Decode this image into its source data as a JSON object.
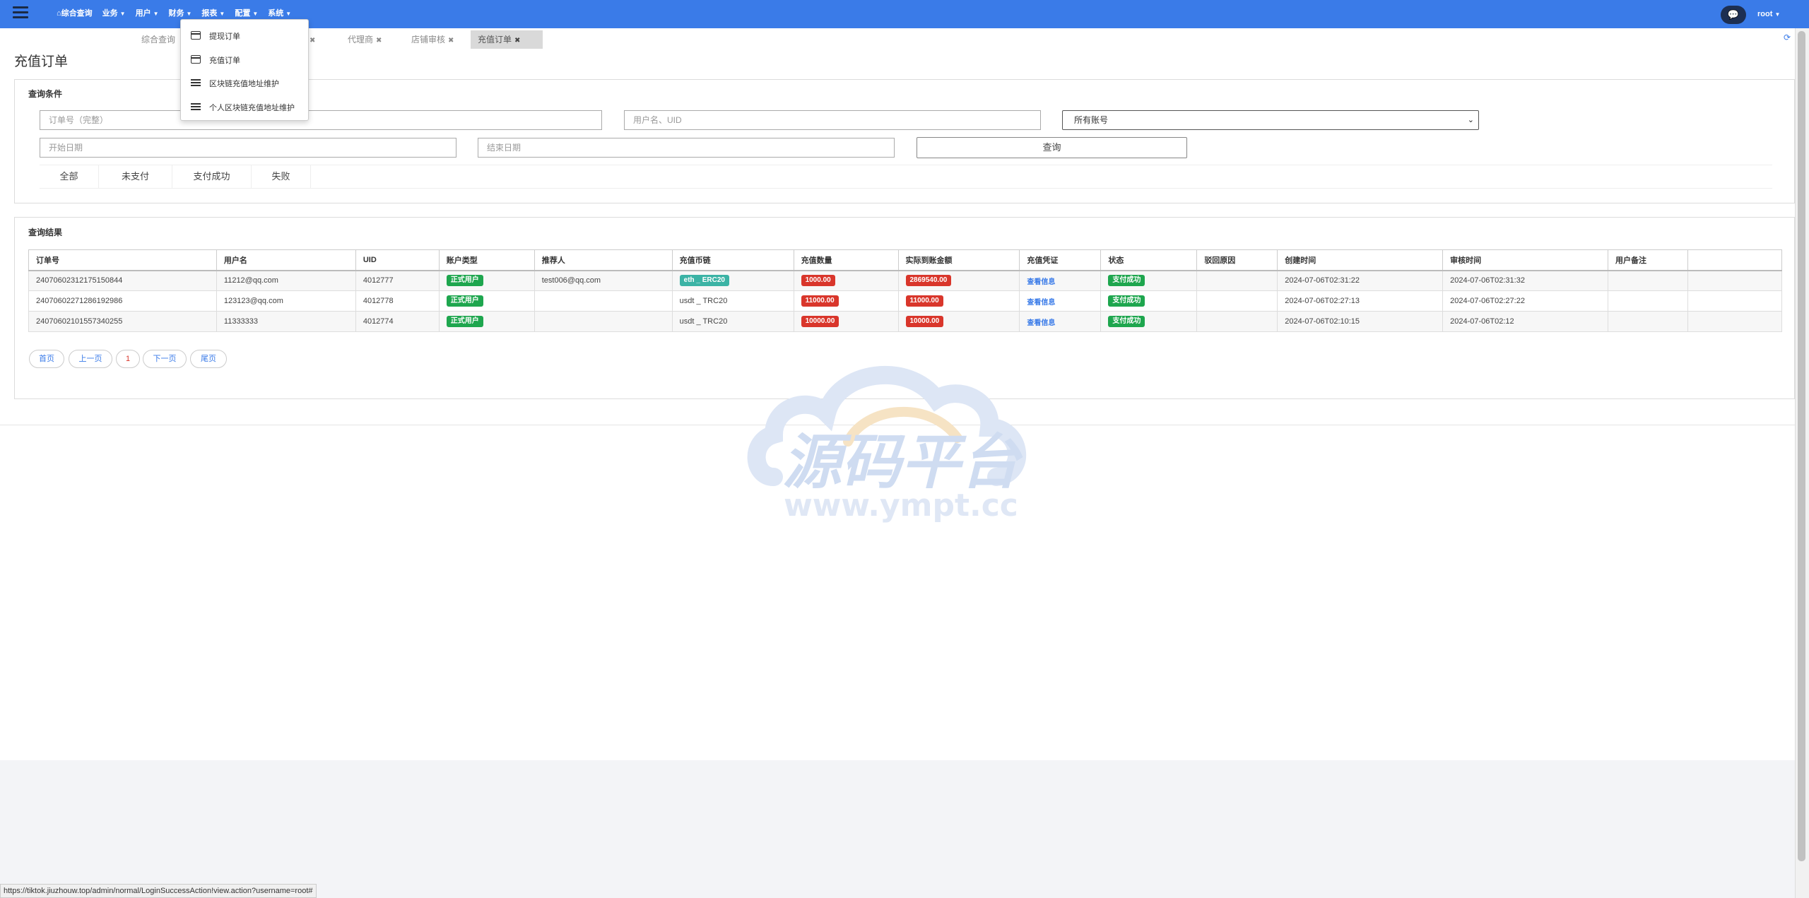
{
  "nav": {
    "items": [
      {
        "label": "综合查询",
        "has_home_icon": true
      },
      {
        "label": "业务"
      },
      {
        "label": "用户"
      },
      {
        "label": "财务"
      },
      {
        "label": "报表"
      },
      {
        "label": "配置"
      },
      {
        "label": "系统"
      }
    ],
    "user": "root"
  },
  "tabs": [
    {
      "label": "综合查询",
      "closable": false
    },
    {
      "label": "代理商",
      "closable": true
    },
    {
      "label": "店铺审核",
      "closable": true
    },
    {
      "label": "充值订单",
      "closable": true,
      "active": true
    }
  ],
  "dropdown": {
    "items": [
      {
        "label": "提现订单",
        "icon": "card-icon"
      },
      {
        "label": "充值订单",
        "icon": "card-icon"
      },
      {
        "label": "区块链充值地址维护",
        "icon": "list-icon"
      },
      {
        "label": "个人区块链充值地址维护",
        "icon": "list-icon"
      }
    ]
  },
  "page": {
    "title": "充值订单"
  },
  "query": {
    "title": "查询条件",
    "order_no_placeholder": "订单号（完整）",
    "user_placeholder": "用户名、UID",
    "account_select": "所有账号",
    "start_date_placeholder": "开始日期",
    "end_date_placeholder": "结束日期",
    "query_button": "查询",
    "status_tabs": [
      "全部",
      "未支付",
      "支付成功",
      "失败"
    ]
  },
  "results": {
    "title": "查询结果",
    "columns": [
      "订单号",
      "用户名",
      "UID",
      "账户类型",
      "推荐人",
      "充值币链",
      "充值数量",
      "实际到账金额",
      "充值凭证",
      "状态",
      "驳回原因",
      "创建时间",
      "审核时间",
      "用户备注",
      ""
    ],
    "rows": [
      {
        "order_no": "24070602312175150844",
        "username": "11212@qq.com",
        "uid": "4012777",
        "account_type": "正式用户",
        "referrer": "test006@qq.com",
        "coin_chain": "eth _ ERC20",
        "coin_chain_badge": true,
        "amount": "1000.00",
        "actual_amount": "2869540.00",
        "voucher": "查看信息",
        "status": "支付成功",
        "reject_reason": "",
        "created_at": "2024-07-06T02:31:22",
        "reviewed_at": "2024-07-06T02:31:32",
        "remark": ""
      },
      {
        "order_no": "24070602271286192986",
        "username": "123123@qq.com",
        "uid": "4012778",
        "account_type": "正式用户",
        "referrer": "",
        "coin_chain": "usdt _ TRC20",
        "coin_chain_badge": false,
        "amount": "11000.00",
        "actual_amount": "11000.00",
        "voucher": "查看信息",
        "status": "支付成功",
        "reject_reason": "",
        "created_at": "2024-07-06T02:27:13",
        "reviewed_at": "2024-07-06T02:27:22",
        "remark": ""
      },
      {
        "order_no": "24070602101557340255",
        "username": "11333333",
        "uid": "4012774",
        "account_type": "正式用户",
        "referrer": "",
        "coin_chain": "usdt _ TRC20",
        "coin_chain_badge": false,
        "amount": "10000.00",
        "actual_amount": "10000.00",
        "voucher": "查看信息",
        "status": "支付成功",
        "reject_reason": "",
        "created_at": "2024-07-06T02:10:15",
        "reviewed_at": "2024-07-06T02:12",
        "remark": ""
      }
    ]
  },
  "pagination": {
    "first": "首页",
    "prev": "上一页",
    "current": "1",
    "next": "下一页",
    "last": "尾页"
  },
  "status_bar": {
    "url": "https://tiktok.jiuzhouw.top/admin/normal/LoginSuccessAction!view.action?username=root#"
  },
  "watermark": {
    "text_cn": "源码平台",
    "text_url": "www.ympt.cc"
  },
  "colors": {
    "nav_bg": "#3a7be8",
    "badge_green": "#1ea64e",
    "badge_red": "#d9362b",
    "badge_teal": "#3bb3a5",
    "link": "#3a7be8"
  }
}
